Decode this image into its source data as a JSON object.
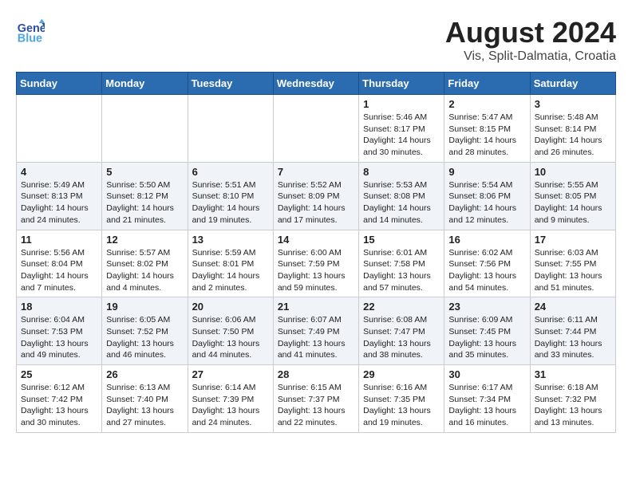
{
  "header": {
    "logo_line1": "General",
    "logo_line2": "Blue",
    "month_year": "August 2024",
    "location": "Vis, Split-Dalmatia, Croatia"
  },
  "days_of_week": [
    "Sunday",
    "Monday",
    "Tuesday",
    "Wednesday",
    "Thursday",
    "Friday",
    "Saturday"
  ],
  "weeks": [
    [
      {
        "day": "",
        "info": ""
      },
      {
        "day": "",
        "info": ""
      },
      {
        "day": "",
        "info": ""
      },
      {
        "day": "",
        "info": ""
      },
      {
        "day": "1",
        "info": "Sunrise: 5:46 AM\nSunset: 8:17 PM\nDaylight: 14 hours\nand 30 minutes."
      },
      {
        "day": "2",
        "info": "Sunrise: 5:47 AM\nSunset: 8:15 PM\nDaylight: 14 hours\nand 28 minutes."
      },
      {
        "day": "3",
        "info": "Sunrise: 5:48 AM\nSunset: 8:14 PM\nDaylight: 14 hours\nand 26 minutes."
      }
    ],
    [
      {
        "day": "4",
        "info": "Sunrise: 5:49 AM\nSunset: 8:13 PM\nDaylight: 14 hours\nand 24 minutes."
      },
      {
        "day": "5",
        "info": "Sunrise: 5:50 AM\nSunset: 8:12 PM\nDaylight: 14 hours\nand 21 minutes."
      },
      {
        "day": "6",
        "info": "Sunrise: 5:51 AM\nSunset: 8:10 PM\nDaylight: 14 hours\nand 19 minutes."
      },
      {
        "day": "7",
        "info": "Sunrise: 5:52 AM\nSunset: 8:09 PM\nDaylight: 14 hours\nand 17 minutes."
      },
      {
        "day": "8",
        "info": "Sunrise: 5:53 AM\nSunset: 8:08 PM\nDaylight: 14 hours\nand 14 minutes."
      },
      {
        "day": "9",
        "info": "Sunrise: 5:54 AM\nSunset: 8:06 PM\nDaylight: 14 hours\nand 12 minutes."
      },
      {
        "day": "10",
        "info": "Sunrise: 5:55 AM\nSunset: 8:05 PM\nDaylight: 14 hours\nand 9 minutes."
      }
    ],
    [
      {
        "day": "11",
        "info": "Sunrise: 5:56 AM\nSunset: 8:04 PM\nDaylight: 14 hours\nand 7 minutes."
      },
      {
        "day": "12",
        "info": "Sunrise: 5:57 AM\nSunset: 8:02 PM\nDaylight: 14 hours\nand 4 minutes."
      },
      {
        "day": "13",
        "info": "Sunrise: 5:59 AM\nSunset: 8:01 PM\nDaylight: 14 hours\nand 2 minutes."
      },
      {
        "day": "14",
        "info": "Sunrise: 6:00 AM\nSunset: 7:59 PM\nDaylight: 13 hours\nand 59 minutes."
      },
      {
        "day": "15",
        "info": "Sunrise: 6:01 AM\nSunset: 7:58 PM\nDaylight: 13 hours\nand 57 minutes."
      },
      {
        "day": "16",
        "info": "Sunrise: 6:02 AM\nSunset: 7:56 PM\nDaylight: 13 hours\nand 54 minutes."
      },
      {
        "day": "17",
        "info": "Sunrise: 6:03 AM\nSunset: 7:55 PM\nDaylight: 13 hours\nand 51 minutes."
      }
    ],
    [
      {
        "day": "18",
        "info": "Sunrise: 6:04 AM\nSunset: 7:53 PM\nDaylight: 13 hours\nand 49 minutes."
      },
      {
        "day": "19",
        "info": "Sunrise: 6:05 AM\nSunset: 7:52 PM\nDaylight: 13 hours\nand 46 minutes."
      },
      {
        "day": "20",
        "info": "Sunrise: 6:06 AM\nSunset: 7:50 PM\nDaylight: 13 hours\nand 44 minutes."
      },
      {
        "day": "21",
        "info": "Sunrise: 6:07 AM\nSunset: 7:49 PM\nDaylight: 13 hours\nand 41 minutes."
      },
      {
        "day": "22",
        "info": "Sunrise: 6:08 AM\nSunset: 7:47 PM\nDaylight: 13 hours\nand 38 minutes."
      },
      {
        "day": "23",
        "info": "Sunrise: 6:09 AM\nSunset: 7:45 PM\nDaylight: 13 hours\nand 35 minutes."
      },
      {
        "day": "24",
        "info": "Sunrise: 6:11 AM\nSunset: 7:44 PM\nDaylight: 13 hours\nand 33 minutes."
      }
    ],
    [
      {
        "day": "25",
        "info": "Sunrise: 6:12 AM\nSunset: 7:42 PM\nDaylight: 13 hours\nand 30 minutes."
      },
      {
        "day": "26",
        "info": "Sunrise: 6:13 AM\nSunset: 7:40 PM\nDaylight: 13 hours\nand 27 minutes."
      },
      {
        "day": "27",
        "info": "Sunrise: 6:14 AM\nSunset: 7:39 PM\nDaylight: 13 hours\nand 24 minutes."
      },
      {
        "day": "28",
        "info": "Sunrise: 6:15 AM\nSunset: 7:37 PM\nDaylight: 13 hours\nand 22 minutes."
      },
      {
        "day": "29",
        "info": "Sunrise: 6:16 AM\nSunset: 7:35 PM\nDaylight: 13 hours\nand 19 minutes."
      },
      {
        "day": "30",
        "info": "Sunrise: 6:17 AM\nSunset: 7:34 PM\nDaylight: 13 hours\nand 16 minutes."
      },
      {
        "day": "31",
        "info": "Sunrise: 6:18 AM\nSunset: 7:32 PM\nDaylight: 13 hours\nand 13 minutes."
      }
    ]
  ]
}
